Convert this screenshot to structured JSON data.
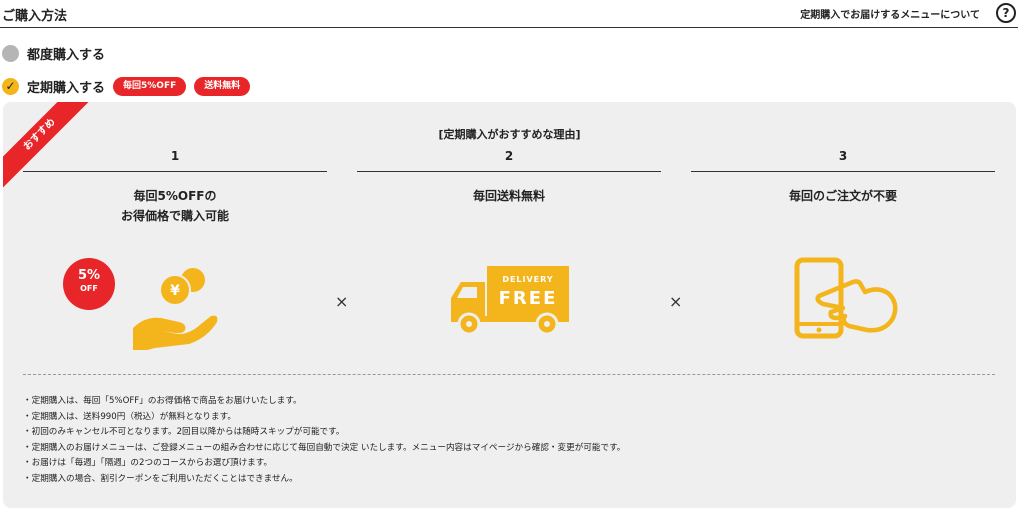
{
  "header": {
    "title": "ご購入方法",
    "info_link": "定期購入でお届けするメニューについて",
    "help_glyph": "?"
  },
  "options": {
    "one_time": {
      "label": "都度購入する",
      "selected": false
    },
    "subscription": {
      "label": "定期購入する",
      "selected": true,
      "check_glyph": "✓",
      "badges": [
        "毎回5%OFF",
        "送料無料"
      ]
    }
  },
  "panel": {
    "ribbon": "おすすめ",
    "title": "[定期購入がおすすめな理由]",
    "reasons": [
      {
        "number": "1",
        "title_line1": "毎回5%OFFの",
        "title_line2": "お得価格で購入可能"
      },
      {
        "number": "2",
        "title_line1": "毎回送料無料",
        "title_line2": ""
      },
      {
        "number": "3",
        "title_line1": "毎回のご注文が不要",
        "title_line2": ""
      }
    ],
    "discount_badge": {
      "pct": "5%",
      "label": "OFF"
    },
    "truck_text": {
      "top": "DELIVERY",
      "main": "FREE"
    },
    "coin_symbol": "¥",
    "times_glyph": "×",
    "notes": [
      "・定期購入は、毎回「5%OFF」のお得価格で商品をお届けいたします。",
      "・定期購入は、送料990円（税込）が無料となります。",
      "・初回のみキャンセル不可となります。2回目以降からは随時スキップが可能です。",
      "・定期購入のお届けメニューは、ご登録メニューの組み合わせに応じて毎回自動で決定 いたします。メニュー内容はマイページから確認・変更が可能です。",
      "・お届けは「毎週」「隔週」の2つのコースからお選び頂けます。",
      "・定期購入の場合、割引クーポンをご利用いただくことはできません。"
    ]
  },
  "colors": {
    "accent_yellow": "#f3b51b",
    "badge_red": "#e8262a",
    "panel_bg": "#efefef"
  }
}
